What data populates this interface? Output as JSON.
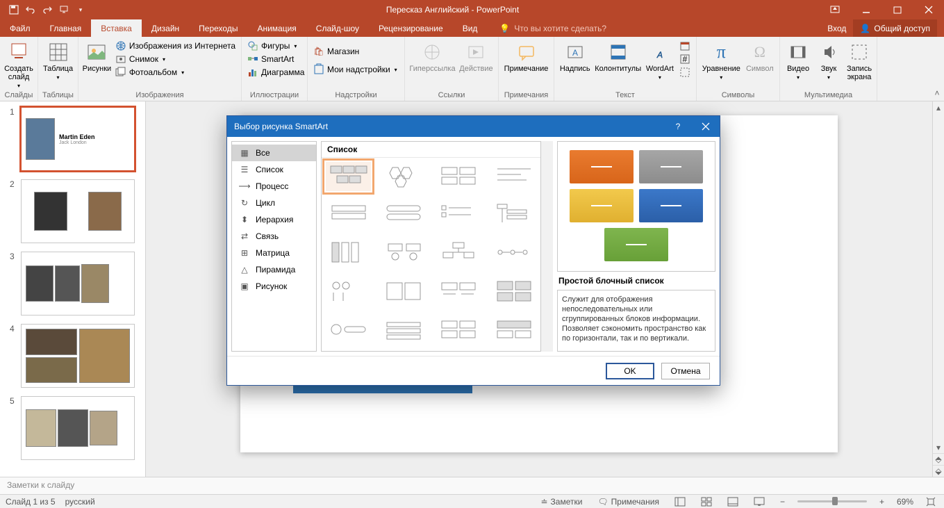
{
  "title": "Пересказ Английский - PowerPoint",
  "menu": {
    "file": "Файл",
    "home": "Главная",
    "insert": "Вставка",
    "design": "Дизайн",
    "transitions": "Переходы",
    "animations": "Анимация",
    "slideshow": "Слайд-шоу",
    "review": "Рецензирование",
    "view": "Вид"
  },
  "tell_me": "Что вы хотите сделать?",
  "signin": "Вход",
  "share": "Общий доступ",
  "ribbon": {
    "slides": {
      "label": "Слайды",
      "new_slide": "Создать слайд"
    },
    "tables": {
      "label": "Таблицы",
      "table": "Таблица"
    },
    "images": {
      "label": "Изображения",
      "pictures": "Рисунки",
      "online": "Изображения из Интернета",
      "screenshot": "Снимок",
      "album": "Фотоальбом"
    },
    "illustrations": {
      "label": "Иллюстрации",
      "shapes": "Фигуры",
      "smartart": "SmartArt",
      "chart": "Диаграмма"
    },
    "addins": {
      "label": "Надстройки",
      "store": "Магазин",
      "myaddins": "Мои надстройки"
    },
    "links": {
      "label": "Ссылки",
      "hyperlink": "Гиперссылка",
      "action": "Действие"
    },
    "comments": {
      "label": "Примечания",
      "comment": "Примечание"
    },
    "text": {
      "label": "Текст",
      "textbox": "Надпись",
      "header": "Колонтитулы",
      "wordart": "WordArt"
    },
    "symbols": {
      "label": "Символы",
      "equation": "Уравнение",
      "symbol": "Символ"
    },
    "media": {
      "label": "Мультимедиа",
      "video": "Видео",
      "audio": "Звук",
      "record": "Запись экрана"
    }
  },
  "thumb1": {
    "title": "Martin Eden",
    "sub": "Jack London"
  },
  "notes": "Заметки к слайду",
  "status": {
    "slide": "Слайд 1 из 5",
    "lang": "русский",
    "notes": "Заметки",
    "comments": "Примечания",
    "zoom": "69%"
  },
  "dialog": {
    "title": "Выбор рисунка SmartArt",
    "cats": [
      "Все",
      "Список",
      "Процесс",
      "Цикл",
      "Иерархия",
      "Связь",
      "Матрица",
      "Пирамида",
      "Рисунок"
    ],
    "list_hdr": "Список",
    "preview_name": "Простой блочный список",
    "preview_desc": "Служит для отображения непоследовательных или сгруппированных блоков информации. Позволяет сэкономить пространство как по горизонтали, так и по вертикали.",
    "ok": "OK",
    "cancel": "Отмена"
  }
}
